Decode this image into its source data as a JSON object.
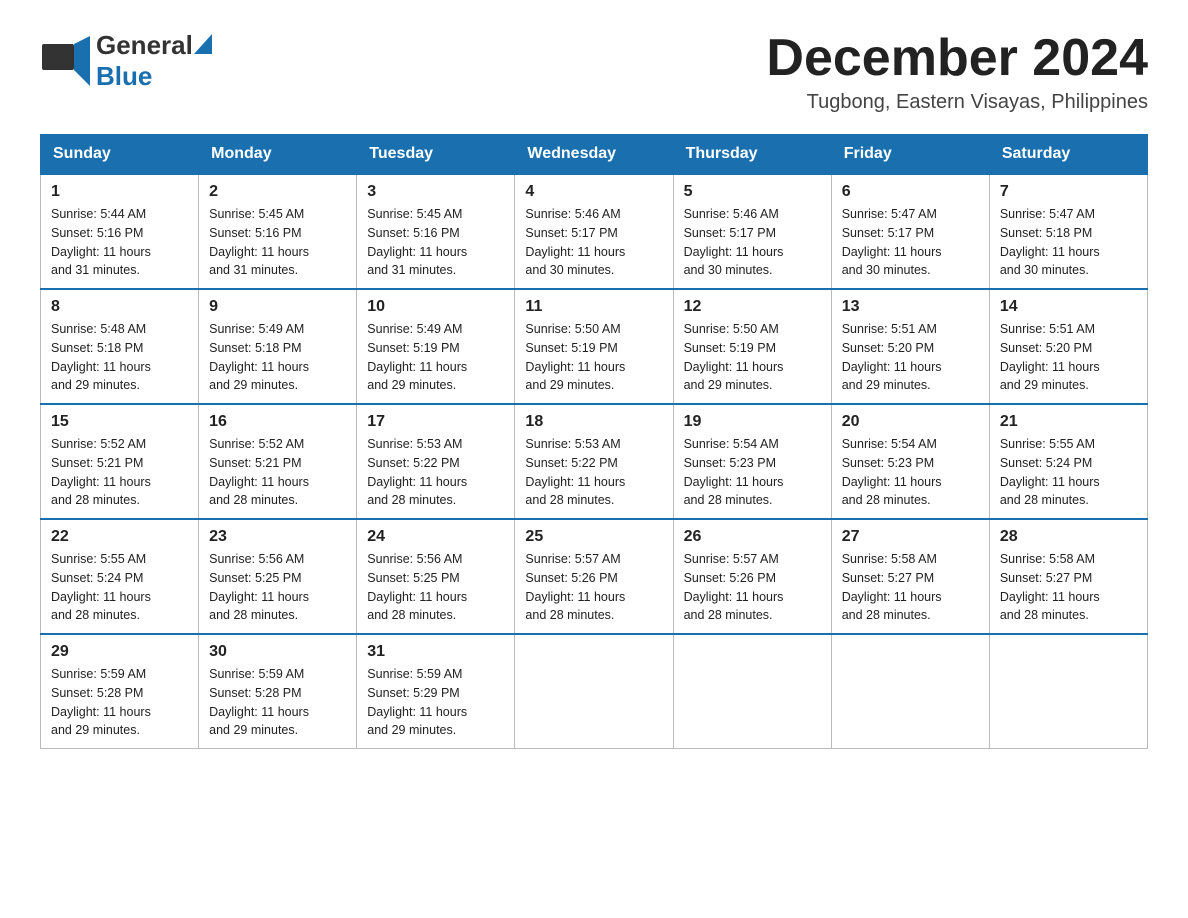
{
  "header": {
    "logo": {
      "general": "General",
      "blue": "Blue"
    },
    "month_year": "December 2024",
    "location": "Tugbong, Eastern Visayas, Philippines"
  },
  "weekdays": [
    "Sunday",
    "Monday",
    "Tuesday",
    "Wednesday",
    "Thursday",
    "Friday",
    "Saturday"
  ],
  "weeks": [
    [
      {
        "day": "1",
        "sunrise": "5:44 AM",
        "sunset": "5:16 PM",
        "daylight": "11 hours and 31 minutes."
      },
      {
        "day": "2",
        "sunrise": "5:45 AM",
        "sunset": "5:16 PM",
        "daylight": "11 hours and 31 minutes."
      },
      {
        "day": "3",
        "sunrise": "5:45 AM",
        "sunset": "5:16 PM",
        "daylight": "11 hours and 31 minutes."
      },
      {
        "day": "4",
        "sunrise": "5:46 AM",
        "sunset": "5:17 PM",
        "daylight": "11 hours and 30 minutes."
      },
      {
        "day": "5",
        "sunrise": "5:46 AM",
        "sunset": "5:17 PM",
        "daylight": "11 hours and 30 minutes."
      },
      {
        "day": "6",
        "sunrise": "5:47 AM",
        "sunset": "5:17 PM",
        "daylight": "11 hours and 30 minutes."
      },
      {
        "day": "7",
        "sunrise": "5:47 AM",
        "sunset": "5:18 PM",
        "daylight": "11 hours and 30 minutes."
      }
    ],
    [
      {
        "day": "8",
        "sunrise": "5:48 AM",
        "sunset": "5:18 PM",
        "daylight": "11 hours and 29 minutes."
      },
      {
        "day": "9",
        "sunrise": "5:49 AM",
        "sunset": "5:18 PM",
        "daylight": "11 hours and 29 minutes."
      },
      {
        "day": "10",
        "sunrise": "5:49 AM",
        "sunset": "5:19 PM",
        "daylight": "11 hours and 29 minutes."
      },
      {
        "day": "11",
        "sunrise": "5:50 AM",
        "sunset": "5:19 PM",
        "daylight": "11 hours and 29 minutes."
      },
      {
        "day": "12",
        "sunrise": "5:50 AM",
        "sunset": "5:19 PM",
        "daylight": "11 hours and 29 minutes."
      },
      {
        "day": "13",
        "sunrise": "5:51 AM",
        "sunset": "5:20 PM",
        "daylight": "11 hours and 29 minutes."
      },
      {
        "day": "14",
        "sunrise": "5:51 AM",
        "sunset": "5:20 PM",
        "daylight": "11 hours and 29 minutes."
      }
    ],
    [
      {
        "day": "15",
        "sunrise": "5:52 AM",
        "sunset": "5:21 PM",
        "daylight": "11 hours and 28 minutes."
      },
      {
        "day": "16",
        "sunrise": "5:52 AM",
        "sunset": "5:21 PM",
        "daylight": "11 hours and 28 minutes."
      },
      {
        "day": "17",
        "sunrise": "5:53 AM",
        "sunset": "5:22 PM",
        "daylight": "11 hours and 28 minutes."
      },
      {
        "day": "18",
        "sunrise": "5:53 AM",
        "sunset": "5:22 PM",
        "daylight": "11 hours and 28 minutes."
      },
      {
        "day": "19",
        "sunrise": "5:54 AM",
        "sunset": "5:23 PM",
        "daylight": "11 hours and 28 minutes."
      },
      {
        "day": "20",
        "sunrise": "5:54 AM",
        "sunset": "5:23 PM",
        "daylight": "11 hours and 28 minutes."
      },
      {
        "day": "21",
        "sunrise": "5:55 AM",
        "sunset": "5:24 PM",
        "daylight": "11 hours and 28 minutes."
      }
    ],
    [
      {
        "day": "22",
        "sunrise": "5:55 AM",
        "sunset": "5:24 PM",
        "daylight": "11 hours and 28 minutes."
      },
      {
        "day": "23",
        "sunrise": "5:56 AM",
        "sunset": "5:25 PM",
        "daylight": "11 hours and 28 minutes."
      },
      {
        "day": "24",
        "sunrise": "5:56 AM",
        "sunset": "5:25 PM",
        "daylight": "11 hours and 28 minutes."
      },
      {
        "day": "25",
        "sunrise": "5:57 AM",
        "sunset": "5:26 PM",
        "daylight": "11 hours and 28 minutes."
      },
      {
        "day": "26",
        "sunrise": "5:57 AM",
        "sunset": "5:26 PM",
        "daylight": "11 hours and 28 minutes."
      },
      {
        "day": "27",
        "sunrise": "5:58 AM",
        "sunset": "5:27 PM",
        "daylight": "11 hours and 28 minutes."
      },
      {
        "day": "28",
        "sunrise": "5:58 AM",
        "sunset": "5:27 PM",
        "daylight": "11 hours and 28 minutes."
      }
    ],
    [
      {
        "day": "29",
        "sunrise": "5:59 AM",
        "sunset": "5:28 PM",
        "daylight": "11 hours and 29 minutes."
      },
      {
        "day": "30",
        "sunrise": "5:59 AM",
        "sunset": "5:28 PM",
        "daylight": "11 hours and 29 minutes."
      },
      {
        "day": "31",
        "sunrise": "5:59 AM",
        "sunset": "5:29 PM",
        "daylight": "11 hours and 29 minutes."
      },
      null,
      null,
      null,
      null
    ]
  ],
  "labels": {
    "sunrise": "Sunrise:",
    "sunset": "Sunset:",
    "daylight": "Daylight:"
  }
}
